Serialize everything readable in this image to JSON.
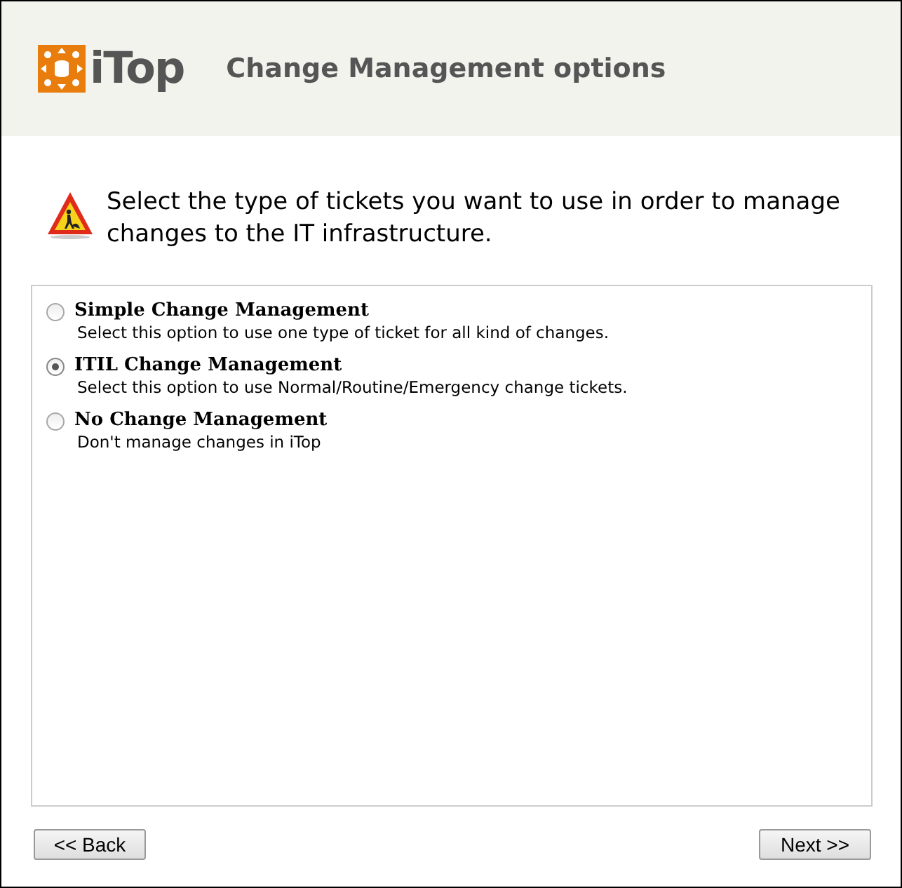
{
  "header": {
    "logo_text": "iTop",
    "title": "Change Management options"
  },
  "intro": "Select the type of tickets you want to use in order to manage changes to the IT infrastructure.",
  "options": [
    {
      "label": "Simple Change Management",
      "description": "Select this option to use one type of ticket for all kind of changes.",
      "selected": false
    },
    {
      "label": "ITIL Change Management",
      "description": "Select this option to use Normal/Routine/Emergency change tickets.",
      "selected": true
    },
    {
      "label": "No Change Management",
      "description": "Don't manage changes in iTop",
      "selected": false
    }
  ],
  "buttons": {
    "back": "<< Back",
    "next": "Next >>"
  }
}
